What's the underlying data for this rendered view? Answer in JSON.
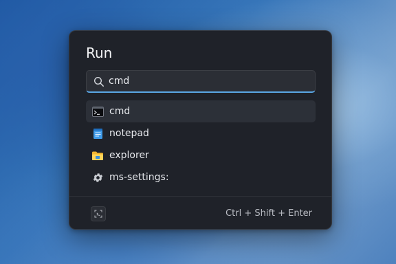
{
  "dialog": {
    "title": "Run"
  },
  "search": {
    "value": "cmd",
    "icon": "search-icon"
  },
  "results": [
    {
      "label": "cmd",
      "icon": "terminal-icon",
      "selected": true
    },
    {
      "label": "notepad",
      "icon": "notepad-icon",
      "selected": false
    },
    {
      "label": "explorer",
      "icon": "folder-icon",
      "selected": false
    },
    {
      "label": "ms-settings:",
      "icon": "gear-icon",
      "selected": false
    }
  ],
  "footer": {
    "icon": "run-as-admin-icon",
    "shortcut": "Ctrl + Shift + Enter"
  },
  "colors": {
    "accent": "#5aa7e6",
    "dialog_bg": "#1f2229"
  }
}
